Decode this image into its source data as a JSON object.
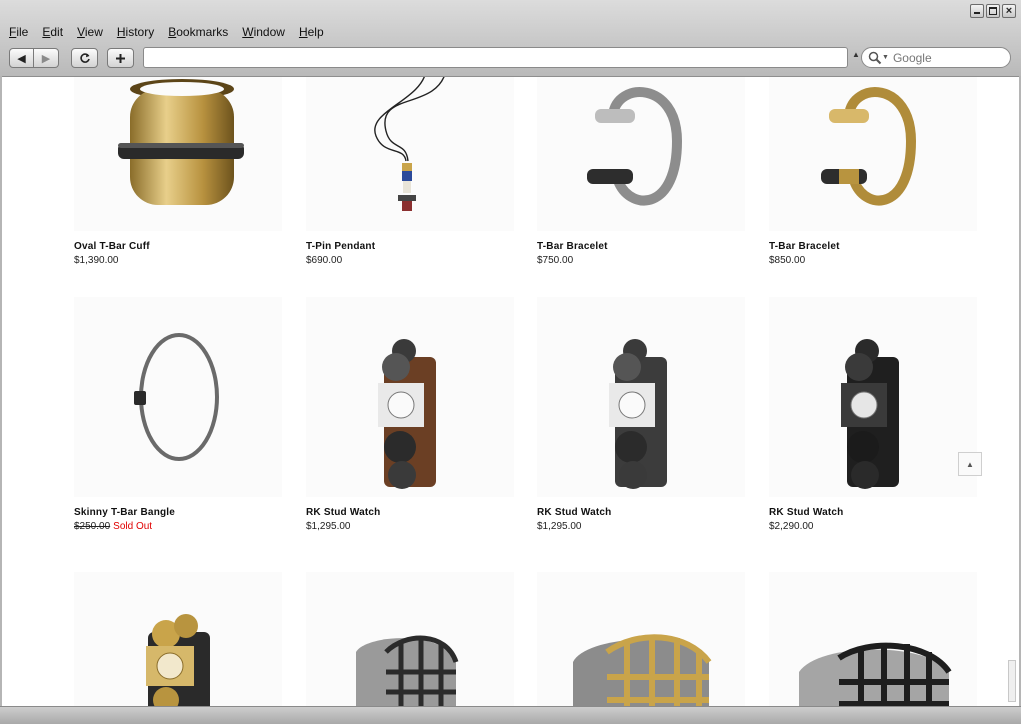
{
  "window": {
    "controls": [
      "minimize",
      "maximize",
      "close"
    ]
  },
  "menubar": [
    "File",
    "Edit",
    "View",
    "History",
    "Bookmarks",
    "Window",
    "Help"
  ],
  "toolbar": {
    "url_value": "",
    "search_placeholder": "Google",
    "icons": [
      "back-arrow-icon",
      "forward-arrow-icon",
      "reload-icon",
      "plus-icon",
      "search-icon"
    ]
  },
  "products": [
    {
      "name": "Oval T-Bar Cuff",
      "price": "$1,390.00",
      "image": "gold-cuff"
    },
    {
      "name": "T-Pin Pendant",
      "price": "$690.00",
      "image": "pendant"
    },
    {
      "name": "T-Bar Bracelet",
      "price": "$750.00",
      "image": "silver-open-bracelet"
    },
    {
      "name": "T-Bar Bracelet",
      "price": "$850.00",
      "image": "gold-open-bracelet"
    },
    {
      "name": "Skinny T-Bar Bangle",
      "price": "$250.00",
      "status": "Sold Out",
      "image": "bangle"
    },
    {
      "name": "RK Stud Watch",
      "price": "$1,295.00",
      "image": "watch-brown"
    },
    {
      "name": "RK Stud Watch",
      "price": "$1,295.00",
      "image": "watch-grey"
    },
    {
      "name": "RK Stud Watch",
      "price": "$2,290.00",
      "image": "watch-black"
    },
    {
      "name": "",
      "price": "",
      "image": "watch-gold"
    },
    {
      "name": "",
      "price": "",
      "image": "grid-cuff-dark"
    },
    {
      "name": "",
      "price": "",
      "image": "grid-cuff-gold"
    },
    {
      "name": "",
      "price": "",
      "image": "grid-cuff-black"
    }
  ],
  "colors": {
    "sold_out": "#e00000",
    "gold": "#c9a44a",
    "chrome_top": "#dcdcdc",
    "chrome_bottom": "#b9b9b9"
  }
}
